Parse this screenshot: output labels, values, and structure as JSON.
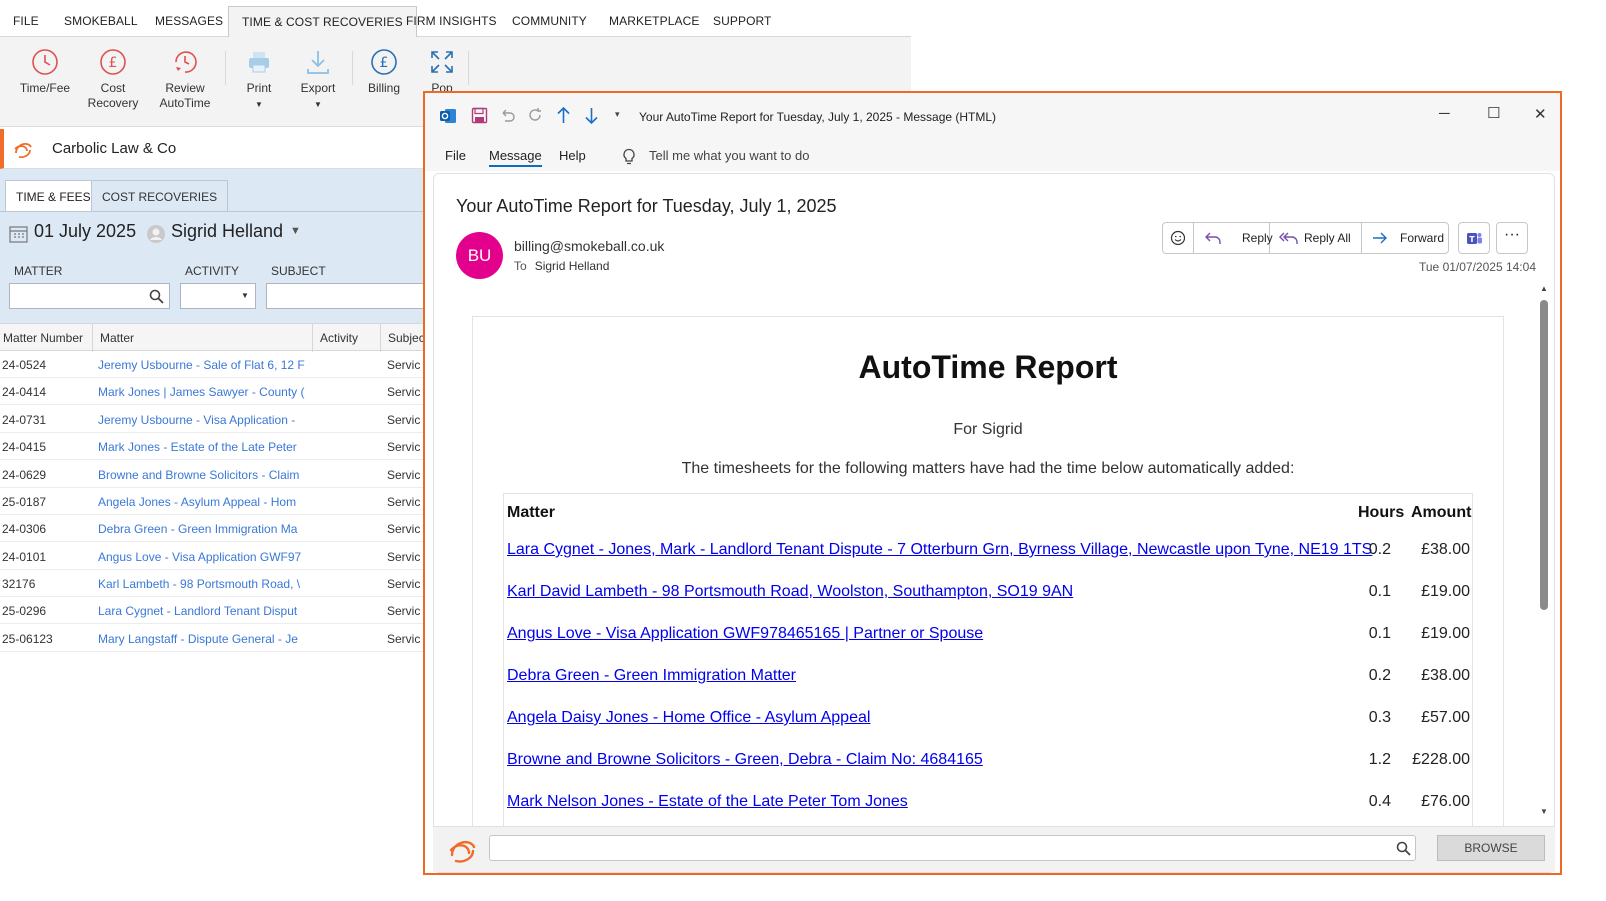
{
  "menubar": {
    "items": [
      "FILE",
      "SMOKEBALL",
      "MESSAGES",
      "TIME & COST RECOVERIES",
      "FIRM INSIGHTS",
      "COMMUNITY",
      "MARKETPLACE",
      "SUPPORT"
    ]
  },
  "ribbon": {
    "time_fee": "Time/Fee",
    "cost_recovery_1": "Cost",
    "cost_recovery_2": "Recovery",
    "review_1": "Review",
    "review_2": "AutoTime",
    "print": "Print",
    "export": "Export",
    "billing": "Billing",
    "pop": "Pop"
  },
  "firm": {
    "name": "Carbolic Law & Co"
  },
  "tabs": {
    "time_fees": "TIME & FEES",
    "cost_recoveries": "COST RECOVERIES"
  },
  "date_row": {
    "date": "01 July 2025",
    "user": "Sigrid Helland"
  },
  "filters": {
    "matter": "MATTER",
    "activity": "ACTIVITY",
    "subject": "SUBJECT"
  },
  "table": {
    "headers": [
      "Matter Number",
      "Matter",
      "Activity",
      "Subjec"
    ],
    "rows": [
      {
        "num": "24-0524",
        "matter": "Jeremy Usbourne - Sale of Flat 6, 12 F",
        "subject": "Servic"
      },
      {
        "num": "24-0414",
        "matter": "Mark Jones | James Sawyer - County (",
        "subject": "Servic"
      },
      {
        "num": "24-0731",
        "matter": "Jeremy Usbourne - Visa Application -",
        "subject": "Servic"
      },
      {
        "num": "24-0415",
        "matter": "Mark Jones - Estate of the Late Peter",
        "subject": "Servic"
      },
      {
        "num": "24-0629",
        "matter": "Browne and Browne Solicitors - Claim",
        "subject": "Servic"
      },
      {
        "num": "25-0187",
        "matter": "Angela Jones - Asylum Appeal - Hom",
        "subject": "Servic"
      },
      {
        "num": "24-0306",
        "matter": "Debra Green - Green Immigration Ma",
        "subject": "Servic"
      },
      {
        "num": "24-0101",
        "matter": "Angus Love - Visa Application GWF97",
        "subject": "Servic"
      },
      {
        "num": "32176",
        "matter": "Karl Lambeth - 98 Portsmouth Road, \\",
        "subject": "Servic"
      },
      {
        "num": "25-0296",
        "matter": "Lara Cygnet - Landlord Tenant Disput",
        "subject": "Servic"
      },
      {
        "num": "25-06123",
        "matter": "Mary Langstaff - Dispute General - Je",
        "subject": "Servic"
      }
    ]
  },
  "outlook": {
    "title": "Your AutoTime Report for Tuesday, July 1, 2025  -  Message (HTML)",
    "tabs": [
      "File",
      "Message",
      "Help"
    ],
    "tell_me": "Tell me what you want to do",
    "subject": "Your AutoTime Report for Tuesday, July 1, 2025",
    "avatar": "BU",
    "from": "billing@smokeball.co.uk",
    "to_label": "To",
    "to": "Sigrid Helland",
    "reply": "Reply",
    "reply_all": "Reply All",
    "forward": "Forward",
    "date": "Tue 01/07/2025 14:04",
    "browse": "BROWSE"
  },
  "report": {
    "title": "AutoTime Report",
    "for": "For Sigrid",
    "intro": "The timesheets for the following matters have had the time below automatically added:",
    "headers": {
      "matter": "Matter",
      "hours": "Hours",
      "amount": "Amount"
    },
    "rows": [
      {
        "matter": "Lara Cygnet - Jones, Mark - Landlord Tenant Dispute - 7 Otterburn Grn, Byrness Village, Newcastle upon Tyne, NE19 1TS",
        "hours": "0.2",
        "amount": "£38.00"
      },
      {
        "matter": "Karl David Lambeth - 98 Portsmouth Road, Woolston, Southampton, SO19 9AN",
        "hours": "0.1",
        "amount": "£19.00"
      },
      {
        "matter": "Angus Love - Visa Application GWF978465165 | Partner or Spouse",
        "hours": "0.1",
        "amount": "£19.00"
      },
      {
        "matter": "Debra Green - Green Immigration Matter",
        "hours": "0.2",
        "amount": "£38.00"
      },
      {
        "matter": "Angela Daisy Jones - Home Office - Asylum Appeal",
        "hours": "0.3",
        "amount": "£57.00"
      },
      {
        "matter": "Browne and Browne Solicitors - Green, Debra - Claim No: 4684165",
        "hours": "1.2",
        "amount": "£228.00"
      },
      {
        "matter": "Mark Nelson Jones - Estate of the Late Peter Tom Jones",
        "hours": "0.4",
        "amount": "£76.00"
      }
    ]
  },
  "colors": {
    "accent": "#ee6a23",
    "link": "#0000ee",
    "avatar": "#e3008c",
    "matter_link": "#3a78d8"
  }
}
